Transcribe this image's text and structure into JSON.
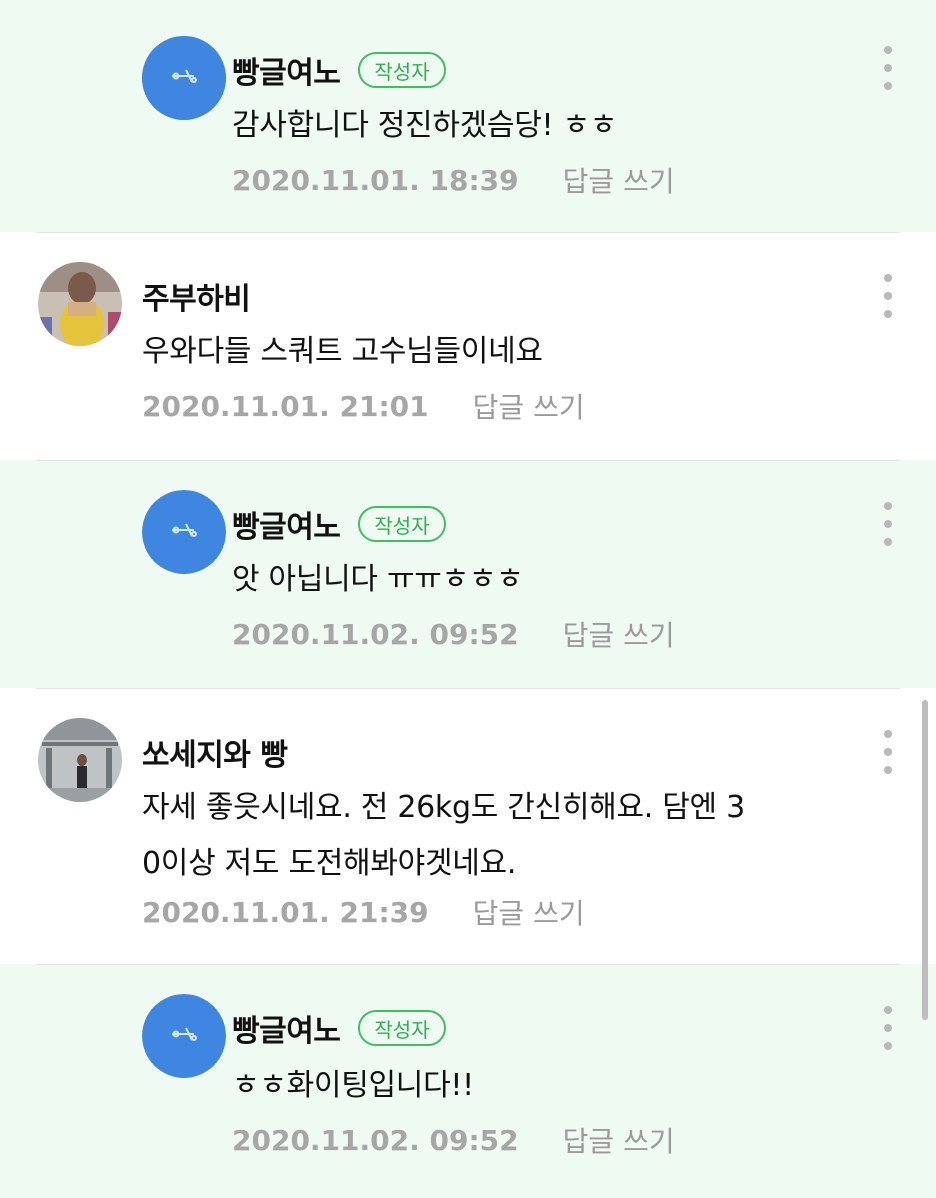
{
  "comments": [
    {
      "author": "빵글여노",
      "badge": "작성자",
      "text_lines": [
        "감사합니다 정진하겠슴당! ㅎㅎ"
      ],
      "time": "2020.11.01. 18:39",
      "reply_label": "답글 쓰기",
      "avatar_icon": "default-profile-icon",
      "is_reply": true
    },
    {
      "author": "주부하비",
      "badge": "",
      "text_lines": [
        "우와다들 스쿼트 고수님들이네요"
      ],
      "time": "2020.11.01. 21:01",
      "reply_label": "답글 쓰기",
      "avatar_icon": "user-photo",
      "is_reply": false
    },
    {
      "author": "빵글여노",
      "badge": "작성자",
      "text_lines": [
        "앗 아닙니다 ㅠㅠㅎㅎㅎ"
      ],
      "time": "2020.11.02. 09:52",
      "reply_label": "답글 쓰기",
      "avatar_icon": "default-profile-icon",
      "is_reply": true
    },
    {
      "author": "쏘세지와 빵",
      "badge": "",
      "text_lines": [
        "자세 좋읏시네요. 전 26kg도 간신히해요. 담엔 3",
        "0이상 저도 도전해봐야겟네요."
      ],
      "time": "2020.11.01. 21:39",
      "reply_label": "답글 쓰기",
      "avatar_icon": "user-photo",
      "is_reply": false
    },
    {
      "author": "빵글여노",
      "badge": "작성자",
      "text_lines": [
        "ㅎㅎ화이팅입니다!!"
      ],
      "time": "2020.11.02. 09:52",
      "reply_label": "답글 쓰기",
      "avatar_icon": "default-profile-icon",
      "is_reply": true
    }
  ],
  "colors": {
    "reply_background": "#effaf2",
    "badge_green": "#2fb050",
    "meta_gray": "#a3a3a3"
  }
}
